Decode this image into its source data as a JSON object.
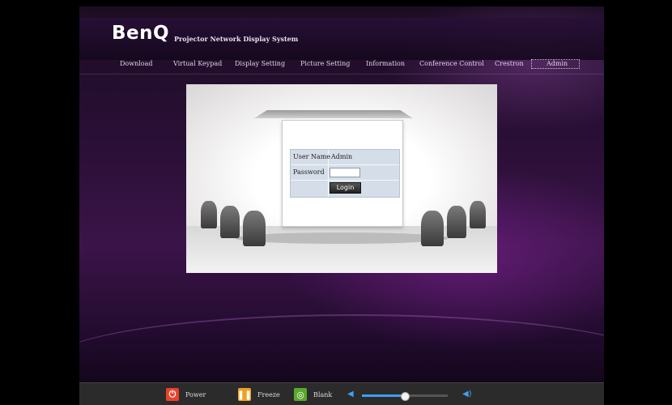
{
  "header": {
    "logo": "BenQ",
    "subtitle": "Projector Network Display System"
  },
  "nav": {
    "items": [
      {
        "label": "Download"
      },
      {
        "label": "Virtual Keypad"
      },
      {
        "label": "Display Setting"
      },
      {
        "label": "Picture Setting"
      },
      {
        "label": "Information"
      },
      {
        "label": "Conference Control"
      },
      {
        "label": "Crestron"
      },
      {
        "label": "Admin"
      }
    ],
    "active": "Admin"
  },
  "login": {
    "username_label": "User Name",
    "username_value": "Admin",
    "password_label": "Password",
    "password_value": "",
    "login_button": "Login"
  },
  "footer": {
    "power_label": "Power",
    "freeze_label": "Freeze",
    "blank_label": "Blank",
    "power_icon": "power-icon",
    "freeze_icon": "pause-icon",
    "blank_icon": "blank-icon",
    "volume_level": 0.5
  },
  "colors": {
    "power": "#e8432a",
    "freeze": "#f0a020",
    "blank": "#5aa82e",
    "volume": "#3ea0f0"
  }
}
